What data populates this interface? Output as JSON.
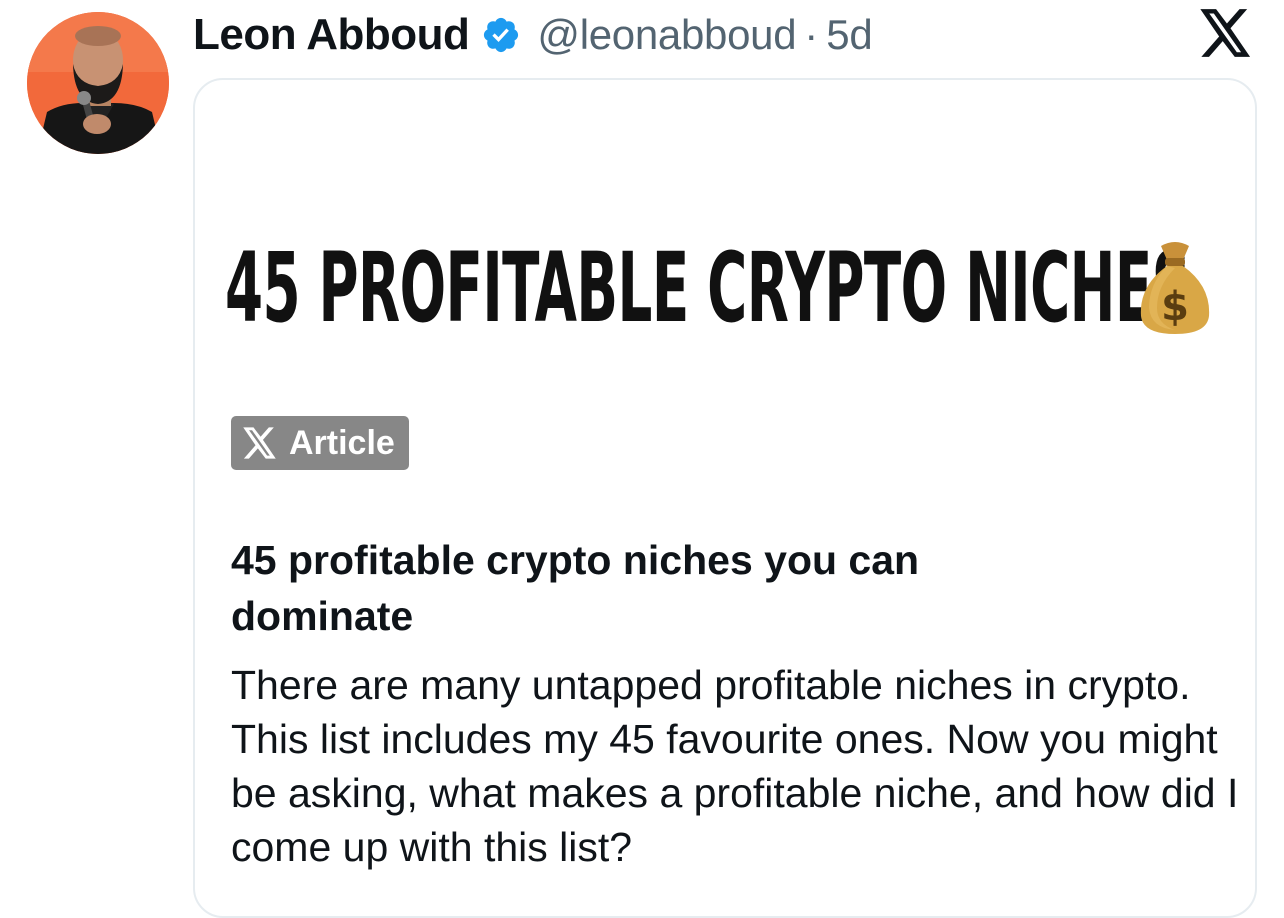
{
  "tweet": {
    "author_name": "Leon Abboud",
    "handle": "@leonabboud",
    "separator": "·",
    "time": "5d"
  },
  "card": {
    "hero_title": "45 PROFITABLE CRYPTO NICHES",
    "hero_icon": "money-bag-icon",
    "badge_label": "Article",
    "article_title": "45 profitable crypto niches you can dominate",
    "article_description": "There are many untapped profitable niches in crypto. This list includes my 45 favourite ones. Now you might be asking, what makes a profitable niche, and how did I come up with this list?"
  },
  "icons": {
    "verified": "verified-badge-icon",
    "platform": "x-logo-icon"
  },
  "colors": {
    "verified_blue": "#1d9bf0",
    "secondary_text": "#536471",
    "badge_gray": "#878787",
    "avatar_bg": "#f26a3d"
  }
}
